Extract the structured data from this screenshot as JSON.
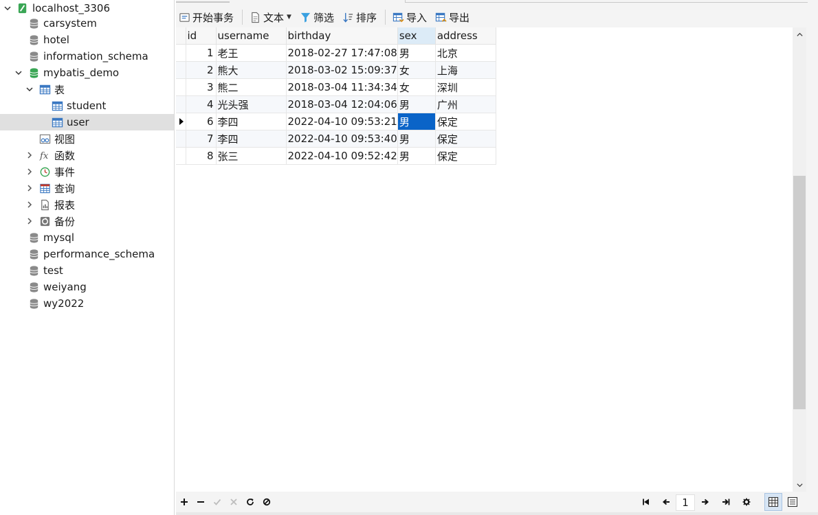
{
  "sidebar": {
    "connection": "localhost_3306",
    "databases": [
      "carsystem",
      "hotel",
      "information_schema"
    ],
    "open_db": "mybatis_demo",
    "tables_group": "表",
    "tables": [
      "student",
      "user"
    ],
    "views": "视图",
    "functions": "函数",
    "events": "事件",
    "queries": "查询",
    "reports": "报表",
    "backups": "备份",
    "more_databases": [
      "mysql",
      "performance_schema",
      "test",
      "weiyang",
      "wy2022"
    ]
  },
  "toolbar": {
    "begin_transaction": "开始事务",
    "text": "文本",
    "filter": "筛选",
    "sort": "排序",
    "import": "导入",
    "export": "导出"
  },
  "grid": {
    "columns": [
      "id",
      "username",
      "birthday",
      "sex",
      "address"
    ],
    "selected_column": "sex",
    "rows": [
      {
        "id": "1",
        "username": "老王",
        "birthday": "2018-02-27 17:47:08",
        "sex": "男",
        "address": "北京"
      },
      {
        "id": "2",
        "username": "熊大",
        "birthday": "2018-03-02 15:09:37",
        "sex": "女",
        "address": "上海"
      },
      {
        "id": "3",
        "username": "熊二",
        "birthday": "2018-03-04 11:34:34",
        "sex": "女",
        "address": "深圳"
      },
      {
        "id": "4",
        "username": "光头强",
        "birthday": "2018-03-04 12:04:06",
        "sex": "男",
        "address": "广州"
      },
      {
        "id": "6",
        "username": "李四",
        "birthday": "2022-04-10 09:53:21",
        "sex": "男",
        "address": "保定"
      },
      {
        "id": "7",
        "username": "李四",
        "birthday": "2022-04-10 09:53:40",
        "sex": "男",
        "address": "保定"
      },
      {
        "id": "8",
        "username": "张三",
        "birthday": "2022-04-10 09:52:42",
        "sex": "男",
        "address": "保定"
      }
    ],
    "current_row_index": 4
  },
  "pager": {
    "page": "1"
  },
  "colors": {
    "selection": "#0a64c8",
    "db_open": "#3aa655",
    "table_icon": "#3a78c2"
  }
}
